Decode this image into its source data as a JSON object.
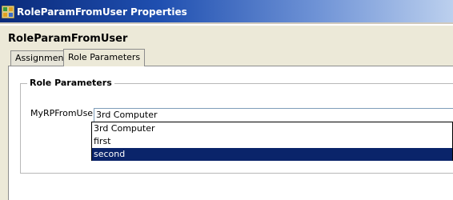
{
  "window": {
    "title": "RoleParamFromUser Properties",
    "icon": "bpel-node-icon"
  },
  "view": {
    "heading": "RoleParamFromUser"
  },
  "tabs": [
    {
      "label": "Assignment",
      "active": false
    },
    {
      "label": "Role Parameters",
      "active": true
    }
  ],
  "role_parameters": {
    "section_title": "Role Parameters",
    "field_label": "MyRPFromUser:",
    "selected_value": "3rd Computer",
    "options": [
      "3rd Computer",
      "first",
      "second"
    ],
    "highlighted_option": "second"
  },
  "colors": {
    "selection": "#0a246a",
    "dialog_background": "#ece9d8"
  }
}
